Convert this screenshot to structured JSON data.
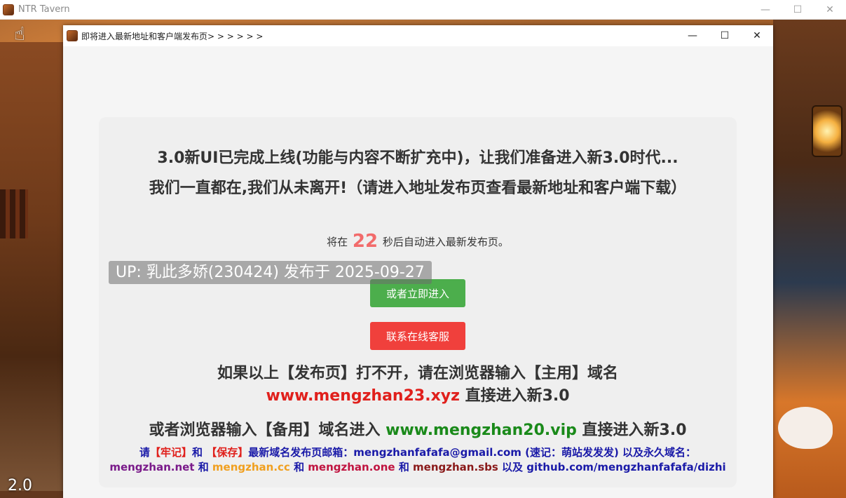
{
  "app": {
    "title": "NTR Tavern",
    "minimize_glyph": "—",
    "maximize_glyph": "☐",
    "close_glyph": "✕",
    "version": "2.0"
  },
  "dialog": {
    "title": "即将进入最新地址和客户端发布页> > > > > >",
    "minimize_glyph": "—",
    "maximize_glyph": "☐",
    "close_glyph": "✕"
  },
  "content": {
    "headline1": "3.0新UI已完成上线(功能与内容不断扩充中)，让我们准备进入新3.0时代...",
    "headline2": "我们一直都在,我们从未离开!（请进入地址发布页查看最新地址和客户端下载）",
    "countdown_prefix": "将在",
    "countdown_value": "22",
    "countdown_suffix": "秒后自动进入最新发布页。",
    "enter_button": "或者立即进入",
    "service_button": "联系在线客服",
    "info1_text": "如果以上【发布页】打不开，请在浏览器输入【主用】域名",
    "info1_domain": "www.mengzhan23.xyz",
    "info1_suffix": " 直接进入新3.0",
    "info2_prefix": "或者浏览器输入【备用】域名进入 ",
    "info2_domain": "www.mengzhan20.vip",
    "info2_suffix": " 直接进入新3.0",
    "footer": {
      "please": "请",
      "remember": "【牢记】",
      "and1": "和",
      "save": "【保存】",
      "email_text": "最新域名发布页邮箱：mengzhanfafafa@gmail.com (速记：萌站发发发) 以及永久域名：",
      "domain1": "mengzhan.net",
      "and2": " 和 ",
      "domain2": "mengzhan.cc",
      "and3": " 和 ",
      "domain3": "mengzhan.one",
      "and4": " 和 ",
      "domain4": "mengzhan.sbs",
      "and5": " 以及 ",
      "domain5": "github.com/mengzhanfafafa/dizhi"
    }
  },
  "overlay": {
    "text": "UP: 乳此多娇(230424) 发布于 2025-09-27"
  },
  "colors": {
    "enter_button": "#4cae4c",
    "service_button": "#f0403c",
    "countdown": "#f26b6b",
    "primary_domain": "#e0201c",
    "backup_domain": "#1a8a1a"
  },
  "icons": {
    "app": "app-logo-icon",
    "cursor": "pointing-hand-icon"
  }
}
